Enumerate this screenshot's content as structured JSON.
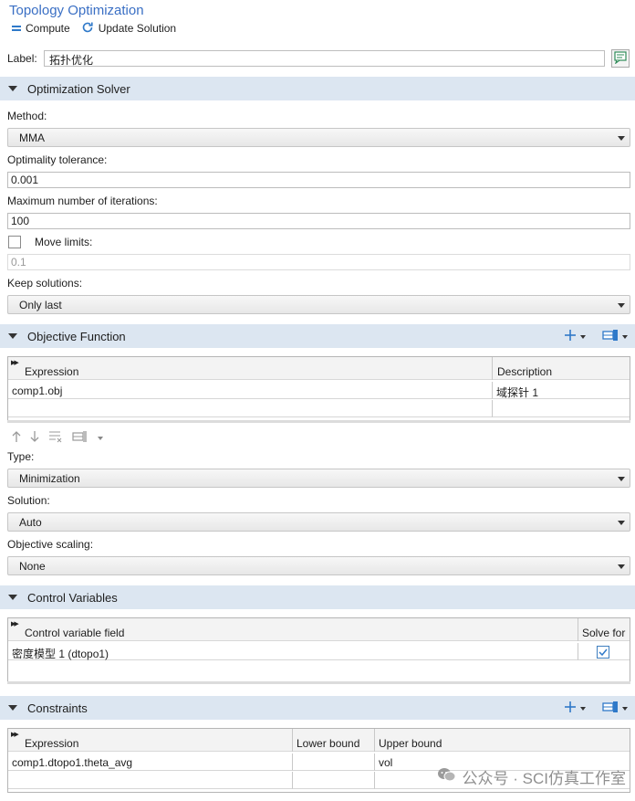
{
  "header": {
    "title": "Topology Optimization",
    "compute_label": "Compute",
    "update_label": "Update Solution"
  },
  "label_field": {
    "caption": "Label:",
    "value": "拓扑优化"
  },
  "optimization_solver": {
    "section_title": "Optimization Solver",
    "method_label": "Method:",
    "method_value": "MMA",
    "tolerance_label": "Optimality tolerance:",
    "tolerance_value": "0.001",
    "max_iter_label": "Maximum number of iterations:",
    "max_iter_value": "100",
    "move_limits_label": "Move limits:",
    "move_limits_checked": false,
    "move_limits_value": "0.1",
    "keep_solutions_label": "Keep solutions:",
    "keep_solutions_value": "Only last"
  },
  "objective_function": {
    "section_title": "Objective Function",
    "columns": [
      "Expression",
      "Description"
    ],
    "rows": [
      {
        "expression": "comp1.obj",
        "description": "域探针 1"
      }
    ],
    "type_label": "Type:",
    "type_value": "Minimization",
    "solution_label": "Solution:",
    "solution_value": "Auto",
    "scaling_label": "Objective scaling:",
    "scaling_value": "None"
  },
  "control_variables": {
    "section_title": "Control Variables",
    "columns": [
      "Control variable field",
      "Solve for"
    ],
    "rows": [
      {
        "field": "密度模型 1 (dtopo1)",
        "solve_for": true
      }
    ]
  },
  "constraints": {
    "section_title": "Constraints",
    "columns": [
      "Expression",
      "Lower bound",
      "Upper bound"
    ],
    "rows": [
      {
        "expression": "comp1.dtopo1.theta_avg",
        "lower": "",
        "upper": "vol"
      }
    ]
  },
  "watermark": {
    "text": "公众号 · SCI仿真工作室"
  },
  "colors": {
    "section_bg": "#dce6f1",
    "title_blue": "#3a6fc4",
    "accent_blue": "#2f79c9"
  }
}
